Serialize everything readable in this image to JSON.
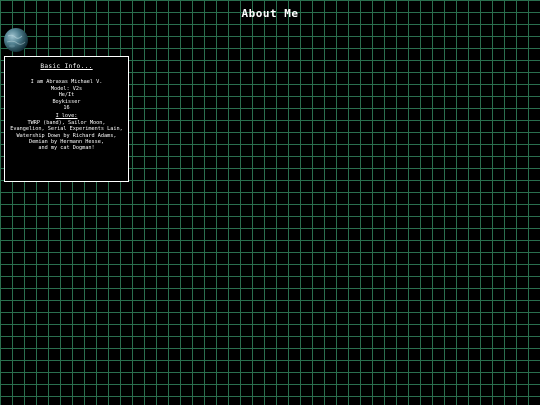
{
  "page": {
    "title": "About Me",
    "background_color": "#000000",
    "grid_color": "#2a6e4e"
  },
  "planet": {
    "icon": "planet-icon"
  },
  "info_box": {
    "title": "Basic Info...",
    "intro_lines": [
      "I am Abraxas Michael V.",
      "Model: V2s",
      "He/It",
      "Boykisser",
      "16"
    ],
    "love_heading": "I love:",
    "love_lines": [
      "TWRP (band), Sailor Moon,",
      "Evangelion, Serial Experiments Lain,",
      "Watership Down by Richard Adams,",
      "Demian by Hermann Hesse,",
      "and my cat Dogman!"
    ]
  }
}
